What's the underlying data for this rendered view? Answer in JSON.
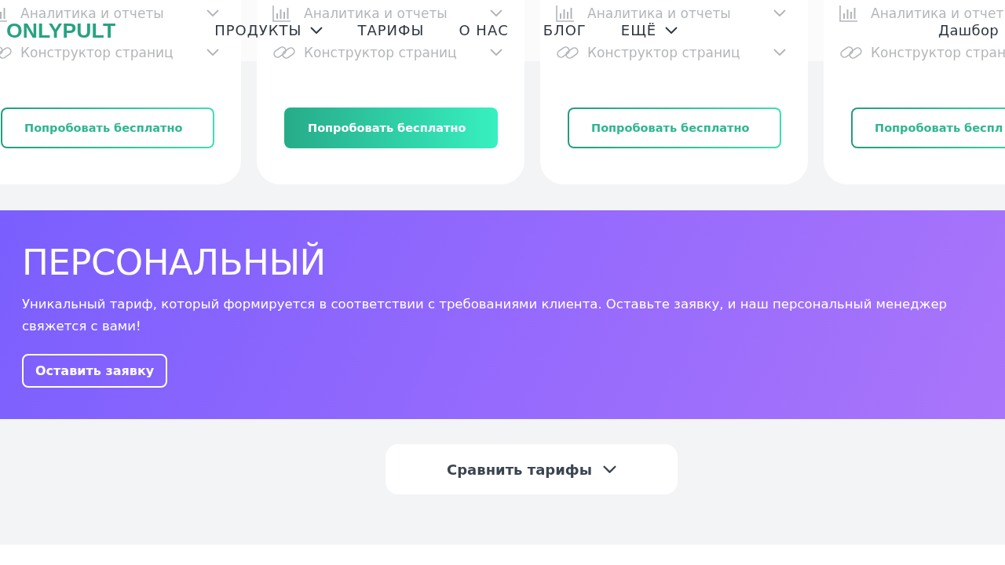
{
  "header": {
    "logo": "ONLYPULT",
    "nav": [
      {
        "label": "ПРОДУКТЫ",
        "has_menu": true
      },
      {
        "label": "ТАРИФЫ",
        "has_menu": false
      },
      {
        "label": "О НАС",
        "has_menu": false
      },
      {
        "label": "БЛОГ",
        "has_menu": false
      },
      {
        "label": "ЕЩЁ",
        "has_menu": true
      }
    ],
    "account_link": "Дашбор"
  },
  "plans": [
    {
      "features": [
        {
          "kind": "chart",
          "label": "Аналитика и отчеты",
          "expanded": false
        },
        {
          "kind": "link",
          "label": "Конструктор страниц",
          "expanded": false
        }
      ],
      "button": {
        "label": "Попробовать бесплатно",
        "primary": false
      }
    },
    {
      "features": [
        {
          "kind": "chart",
          "label": "Аналитика и отчеты",
          "expanded": false
        },
        {
          "kind": "link",
          "label": "Конструктор страниц",
          "expanded": false
        }
      ],
      "button": {
        "label": "Попробовать бесплатно",
        "primary": true
      }
    },
    {
      "features": [
        {
          "kind": "chart",
          "label": "Аналитика и отчеты",
          "expanded": false
        },
        {
          "kind": "link",
          "label": "Конструктор страниц",
          "expanded": false
        }
      ],
      "button": {
        "label": "Попробовать бесплатно",
        "primary": false
      }
    },
    {
      "features": [
        {
          "kind": "chart",
          "label": "Аналитика и отчет"
        },
        {
          "kind": "link",
          "label": "Конструктор стран"
        }
      ],
      "button": {
        "label": "Попробовать беспл",
        "primary": false
      }
    }
  ],
  "personal": {
    "title": "ПЕРСОНАЛЬНЫЙ",
    "description": "Уникальный тариф, который формируется в соответствии с требованиями клиента. Оставьте заявку, и наш персональный менеджер свяжется с вами!",
    "button": "Оставить заявку"
  },
  "compare": {
    "label": "Сравнить тарифы",
    "expanded": false
  }
}
